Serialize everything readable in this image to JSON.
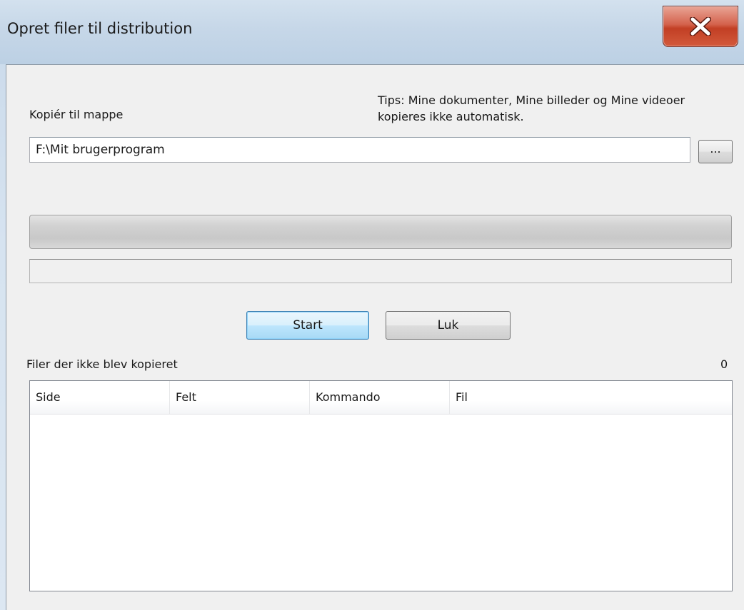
{
  "window": {
    "title": "Opret filer til distribution"
  },
  "form": {
    "copy_label": "Kopiér til mappe",
    "tips": "Tips: Mine dokumenter, Mine billeder og Mine videoer kopieres ikke automatisk.",
    "path_value": "F:\\Mit brugerprogram",
    "browse_label": "...",
    "progress_fraction": 0
  },
  "buttons": {
    "start": "Start",
    "close": "Luk"
  },
  "failed": {
    "label": "Filer der ikke blev kopieret",
    "count": "0",
    "columns": [
      "Side",
      "Felt",
      "Kommando",
      "Fil"
    ],
    "rows": []
  },
  "icons": {
    "close": "close-x-icon"
  },
  "colors": {
    "close_button": "#c8452a",
    "default_button_border": "#3c7fb1"
  }
}
